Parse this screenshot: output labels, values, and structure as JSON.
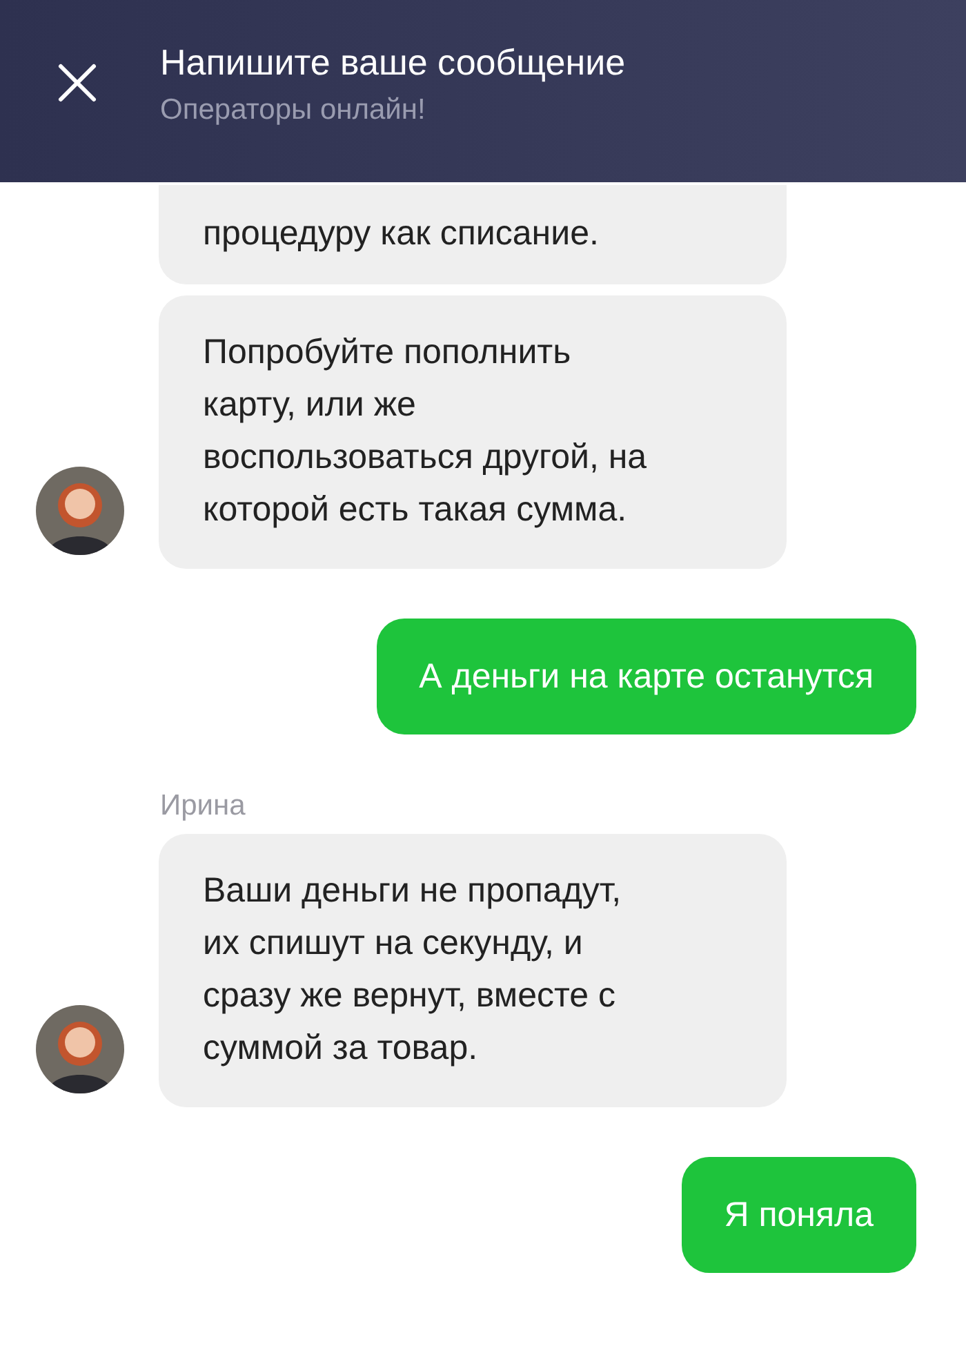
{
  "header": {
    "title": "Напишите ваше сообщение",
    "subtitle": "Операторы онлайн!"
  },
  "messages": [
    {
      "kind": "operator",
      "avatar": false,
      "lines": [
        "процедуру как списание."
      ]
    },
    {
      "kind": "operator",
      "avatar": true,
      "lines": [
        "Попробуйте пополнить",
        "карту, или же",
        "воспользоваться другой, на",
        "которой есть такая сумма."
      ]
    },
    {
      "kind": "user",
      "lines": [
        "А деньги на карте останутся"
      ]
    },
    {
      "kind": "operator",
      "avatar": true,
      "sender": "Ирина",
      "lines": [
        "Ваши деньги не пропадут,",
        "их спишут на секунду, и",
        "сразу же вернут, вместе с",
        "суммой за товар."
      ]
    },
    {
      "kind": "user",
      "lines": [
        "Я поняла"
      ]
    }
  ]
}
